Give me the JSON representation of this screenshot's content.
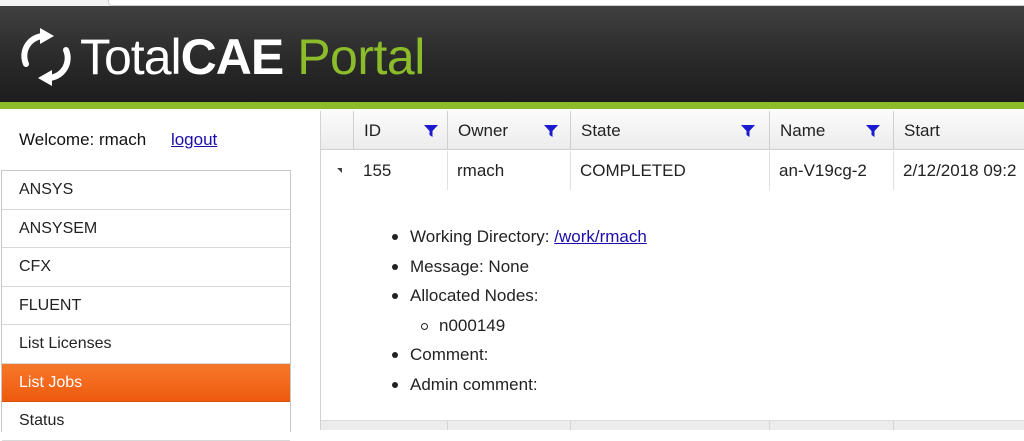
{
  "header": {
    "logo_word1": "Total",
    "logo_word2": "CAE",
    "logo_word3": "Portal",
    "accent_color": "#8cbc2a",
    "logo_mark_icon": "refresh-arrows-icon"
  },
  "user": {
    "welcome_text": "Welcome: rmach",
    "logout_label": "logout"
  },
  "sidebar": {
    "items": [
      {
        "label": "ANSYS"
      },
      {
        "label": "ANSYSEM"
      },
      {
        "label": "CFX"
      },
      {
        "label": "FLUENT"
      },
      {
        "label": "List Licenses"
      },
      {
        "label": "List Jobs",
        "active": true
      },
      {
        "label": "Status"
      }
    ],
    "active_color": "#f26a1b"
  },
  "grid": {
    "columns": [
      "ID",
      "Owner",
      "State",
      "Name",
      "Start"
    ],
    "filter_icon": "funnel-filter-icon",
    "filter_color": "#1a1ad0",
    "rows": [
      {
        "id": "155",
        "owner": "rmach",
        "state": "COMPLETED",
        "name": "an-V19cg-2",
        "start": "2/12/2018 09:2"
      }
    ],
    "detail": {
      "working_directory_label": "Working Directory:",
      "working_directory_value": "/work/rmach",
      "message": "Message: None",
      "allocated_nodes_label": "Allocated Nodes:",
      "nodes": [
        "n000149"
      ],
      "comment": "Comment:",
      "admin_comment": "Admin comment:"
    }
  }
}
